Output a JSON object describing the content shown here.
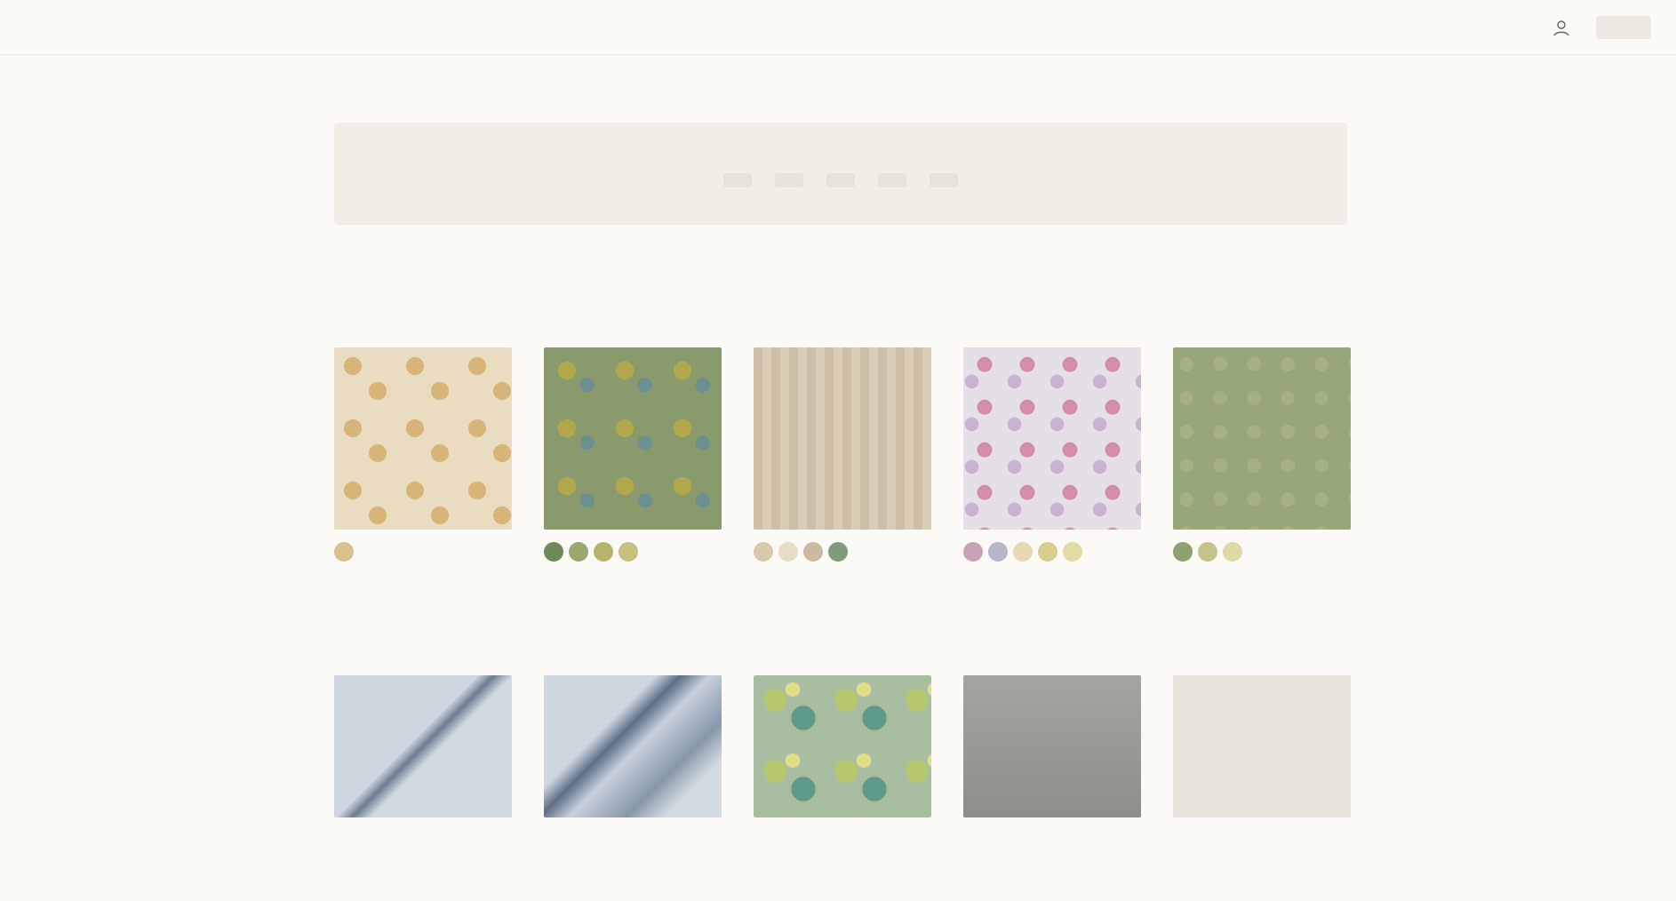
{
  "header": {
    "nav": [
      "",
      ""
    ],
    "brand": "",
    "icons": [
      "account-icon",
      "cart-icon"
    ]
  },
  "page": {
    "title": ""
  },
  "banner": {
    "label": "",
    "links": [
      "",
      "",
      "",
      "",
      ""
    ]
  },
  "filters": [
    {
      "label": "",
      "value": ""
    },
    {
      "label": "",
      "value": ""
    },
    {
      "label": "",
      "value": ""
    },
    {
      "label": "",
      "value": ""
    },
    {
      "label": "",
      "value": ""
    },
    {
      "label": "",
      "value": ""
    }
  ],
  "results": {
    "left": "",
    "right": ""
  },
  "products_row1": [
    {
      "name": "",
      "sub": "",
      "pattern": "sand",
      "colors": [
        "#d9c08c"
      ]
    },
    {
      "name": "",
      "sub": "",
      "pattern": "green",
      "colors": [
        "#6f8a5a",
        "#9aa86f",
        "#b5b46a",
        "#c8c07d"
      ]
    },
    {
      "name": "",
      "sub": "",
      "pattern": "stripe",
      "colors": [
        "#d8c9ad",
        "#e6ddc6",
        "#cdb9a0",
        "#7f9a7e"
      ]
    },
    {
      "name": "",
      "sub": "",
      "pattern": "pink",
      "colors": [
        "#c9a2b6",
        "#b8b7c9",
        "#e6d7b5",
        "#d8cc8f",
        "#e1dba6"
      ]
    },
    {
      "name": "",
      "sub": "",
      "pattern": "sage",
      "colors": [
        "#8ea26d",
        "#c6c28b",
        "#dfd9a6"
      ]
    }
  ],
  "products_row2": [
    {
      "pattern": "blue1"
    },
    {
      "pattern": "blue2"
    },
    {
      "pattern": "floral"
    },
    {
      "pattern": "grey"
    },
    {
      "pattern": "cream"
    }
  ]
}
